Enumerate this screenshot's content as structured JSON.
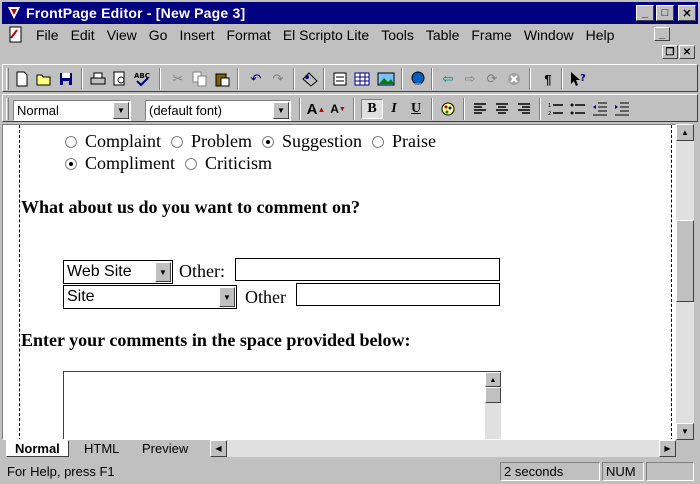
{
  "window": {
    "title": "FrontPage Editor - [New Page 3]",
    "controls": {
      "minimize": "_",
      "maximize": "□",
      "close": "✕"
    }
  },
  "menubar": {
    "items": [
      "File",
      "Edit",
      "View",
      "Go",
      "Insert",
      "Format",
      "El Scripto Lite",
      "Tools",
      "Table",
      "Frame",
      "Window",
      "Help"
    ],
    "mdi_controls": {
      "minimize": "_",
      "restore": "❐",
      "close": "✕"
    }
  },
  "format_toolbar": {
    "style_value": "Normal",
    "font_value": "(default font)",
    "bold": "B",
    "italic": "I",
    "underline": "U"
  },
  "document": {
    "radio_row1": [
      {
        "label": "Complaint",
        "checked": false
      },
      {
        "label": "Problem",
        "checked": false
      },
      {
        "label": "Suggestion",
        "checked": true
      },
      {
        "label": "Praise",
        "checked": false
      }
    ],
    "radio_row2": [
      {
        "label": "Compliment",
        "checked": true
      },
      {
        "label": "Criticism",
        "checked": false
      }
    ],
    "heading1": "What about us do you want to comment on?",
    "select1_value": "Web Site",
    "other1_label": "Other:",
    "select2_value": "Site",
    "other2_label": "Other",
    "heading2": "Enter your comments in the space provided below:"
  },
  "tabs": [
    "Normal",
    "HTML",
    "Preview"
  ],
  "active_tab": "Normal",
  "status": {
    "help": "For Help, press F1",
    "timing": "2 seconds",
    "num": "NUM"
  }
}
